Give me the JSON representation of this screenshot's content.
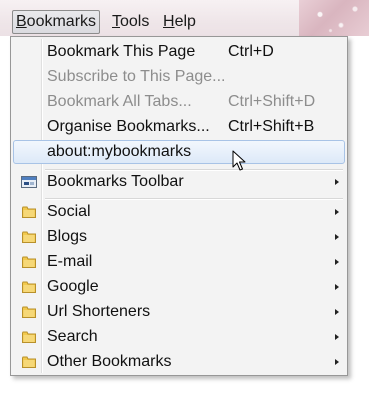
{
  "menubar": {
    "items": [
      {
        "accel": "B",
        "rest": "ookmarks"
      },
      {
        "accel": "T",
        "rest": "ools"
      },
      {
        "accel": "H",
        "rest": "elp"
      }
    ]
  },
  "menu": {
    "items": [
      {
        "label": "Bookmark This Page",
        "shortcut": "Ctrl+D"
      },
      {
        "label": "Subscribe to This Page...",
        "shortcut": ""
      },
      {
        "label": "Bookmark All Tabs...",
        "shortcut": "Ctrl+Shift+D"
      },
      {
        "label": "Organise Bookmarks...",
        "shortcut": "Ctrl+Shift+B"
      },
      {
        "label": "about:mybookmarks",
        "shortcut": ""
      },
      {
        "label": "Bookmarks Toolbar"
      },
      {
        "label": "Social"
      },
      {
        "label": "Blogs"
      },
      {
        "label": "E-mail"
      },
      {
        "label": "Google"
      },
      {
        "label": "Url Shorteners"
      },
      {
        "label": "Search"
      },
      {
        "label": "Other Bookmarks"
      }
    ],
    "disabled_color": "#8d8d8d",
    "highlight_color": "#dde9f8",
    "folder_color": "#f2c94c"
  },
  "icons": {
    "folder": "folder-icon",
    "toolbar": "bookmarks-toolbar-icon",
    "submenu": "submenu-arrow-icon",
    "pointer": "mouse-pointer-icon"
  }
}
